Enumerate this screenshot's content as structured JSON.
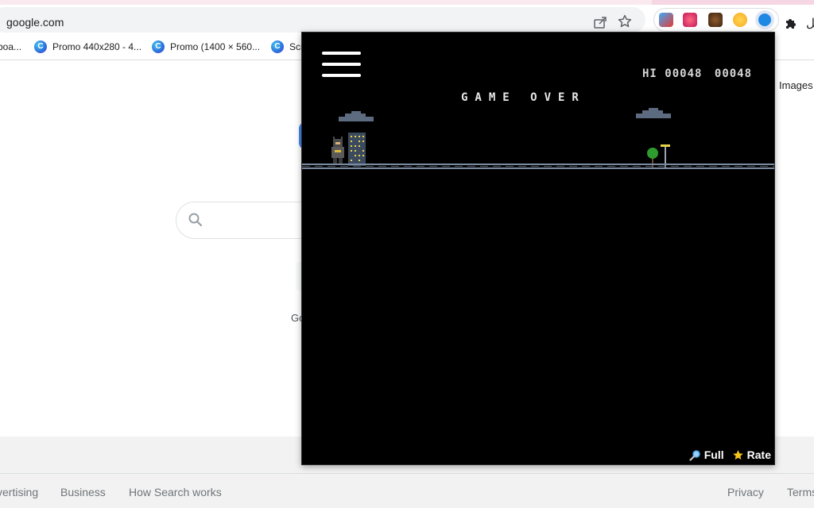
{
  "browser": {
    "url": "google.com",
    "bookmarks": [
      {
        "label": "boa..."
      },
      {
        "label": "Promo 440x280 - 4..."
      },
      {
        "label": "Promo (1400 × 560..."
      },
      {
        "label": "Scr"
      }
    ],
    "profile_glyph": "ىل"
  },
  "google": {
    "images_label": "Images",
    "offered_stub": "Go",
    "footer_links": [
      "vertising",
      "Business",
      "How Search works",
      "Privacy",
      "Terms"
    ]
  },
  "game": {
    "hi_label": "HI",
    "hi_score": "00048",
    "score": "00048",
    "status": "GAME OVER",
    "full_label": "Full",
    "rate_label": "Rate"
  },
  "colors": {
    "game_bg": "#000000",
    "road": "#7a8aa0",
    "building_lights": "#e8d24a"
  }
}
